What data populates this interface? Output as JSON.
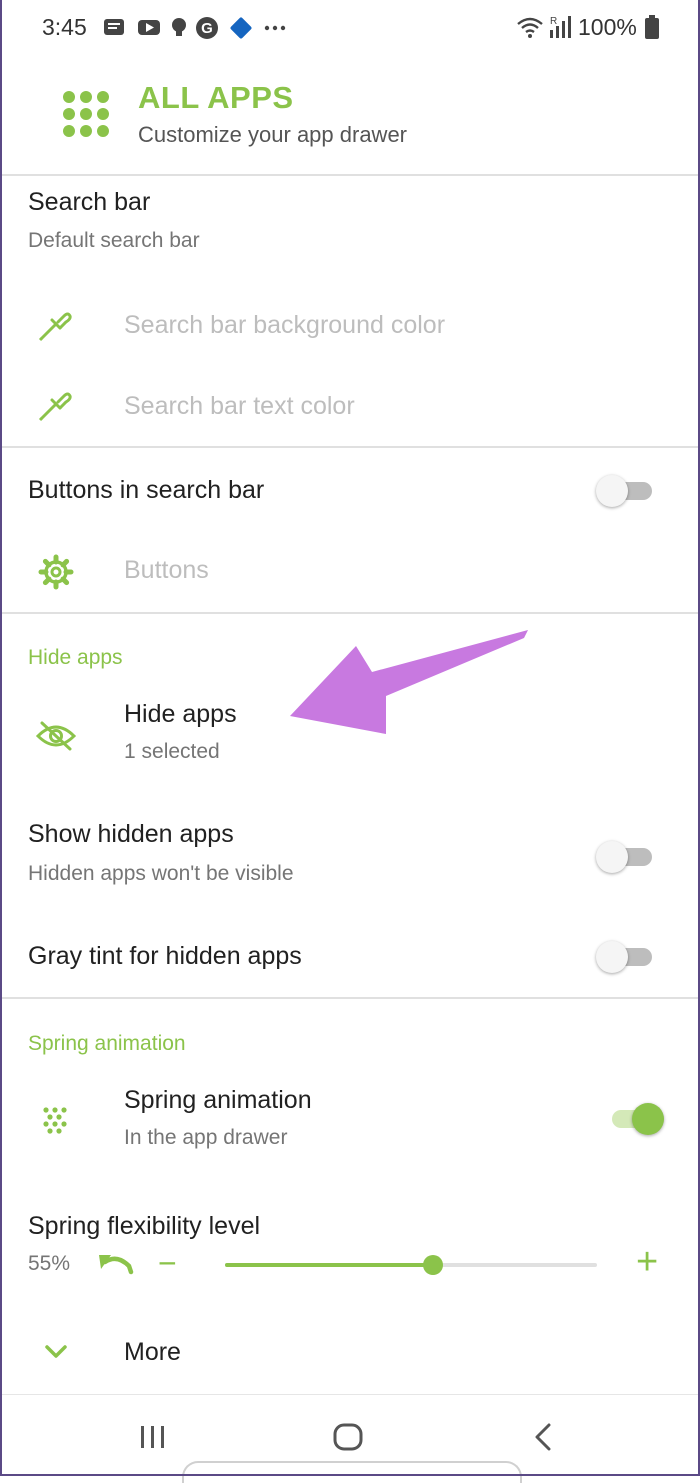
{
  "status_bar": {
    "time": "3:45",
    "battery": "100%",
    "wifi_badge": "R"
  },
  "header": {
    "title": "ALL APPS",
    "subtitle": "Customize your app drawer",
    "icon": "grid-icon"
  },
  "search_bar": {
    "title": "Search bar",
    "subtitle": "Default search bar",
    "bg_color_label": "Search bar background color",
    "text_color_label": "Search bar text color"
  },
  "buttons_in_search": {
    "title": "Buttons in search bar",
    "enabled": false,
    "buttons_label": "Buttons"
  },
  "hide_apps_section": {
    "header": "Hide apps",
    "hide_apps_title": "Hide apps",
    "hide_apps_subtitle": "1 selected",
    "show_hidden_title": "Show hidden apps",
    "show_hidden_subtitle": "Hidden apps won't be visible",
    "show_hidden_enabled": false,
    "gray_tint_title": "Gray tint for hidden apps",
    "gray_tint_enabled": false
  },
  "spring_section": {
    "header": "Spring animation",
    "spring_title": "Spring animation",
    "spring_subtitle": "In the app drawer",
    "spring_enabled": true,
    "flex_title": "Spring flexibility level",
    "flex_value": "55%",
    "flex_fraction": 0.56,
    "minus": "−",
    "plus": "+",
    "more_label": "More"
  },
  "colors": {
    "accent": "#8bc34a",
    "annotation_arrow": "#c879e0"
  }
}
